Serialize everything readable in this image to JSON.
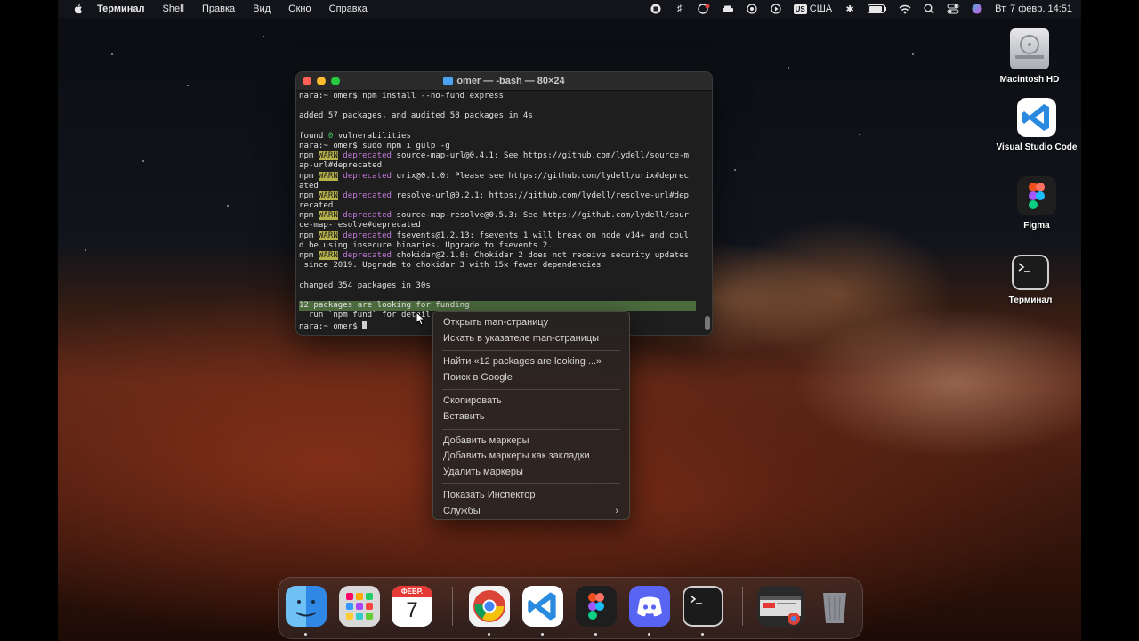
{
  "menubar": {
    "app_name": "Терминал",
    "items": [
      "Shell",
      "Правка",
      "Вид",
      "Окно",
      "Справка"
    ],
    "keyboard_layout": "США",
    "keyboard_badge": "US",
    "datetime": "Вт, 7 февр.  14:51"
  },
  "desktop_icons": [
    {
      "label": "Macintosh HD",
      "icon": "hard-drive-icon"
    },
    {
      "label": "Visual Studio Code",
      "icon": "vscode-icon"
    },
    {
      "label": "Figma",
      "icon": "figma-icon"
    },
    {
      "label": "Терминал",
      "icon": "terminal-icon"
    }
  ],
  "terminal": {
    "title": "omer — -bash — 80×24",
    "lines": [
      {
        "t": "nara:~ omer$ npm install --no-fund express"
      },
      {
        "t": ""
      },
      {
        "t": "added 57 packages, and audited 58 packages in 4s"
      },
      {
        "t": ""
      },
      {
        "pre": "found ",
        "zero": "0",
        "post": " vulnerabilities"
      },
      {
        "t": "nara:~ omer$ sudo npm i gulp -g"
      },
      {
        "npm": "npm ",
        "warn": "WARN",
        "dep": " deprecated",
        "post": " source-map-url@0.4.1: See https://github.com/lydell/source-m"
      },
      {
        "t": "ap-url#deprecated"
      },
      {
        "npm": "npm ",
        "warn": "WARN",
        "dep": " deprecated",
        "post": " urix@0.1.0: Please see https://github.com/lydell/urix#deprec"
      },
      {
        "t": "ated"
      },
      {
        "npm": "npm ",
        "warn": "WARN",
        "dep": " deprecated",
        "post": " resolve-url@0.2.1: https://github.com/lydell/resolve-url#dep"
      },
      {
        "t": "recated"
      },
      {
        "npm": "npm ",
        "warn": "WARN",
        "dep": " deprecated",
        "post": " source-map-resolve@0.5.3: See https://github.com/lydell/sour"
      },
      {
        "t": "ce-map-resolve#deprecated"
      },
      {
        "npm": "npm ",
        "warn": "WARN",
        "dep": " deprecated",
        "post": " fsevents@1.2.13: fsevents 1 will break on node v14+ and coul"
      },
      {
        "t": "d be using insecure binaries. Upgrade to fsevents 2."
      },
      {
        "npm": "npm ",
        "warn": "WARN",
        "dep": " deprecated",
        "post": " chokidar@2.1.8: Chokidar 2 does not receive security updates"
      },
      {
        "t": " since 2019. Upgrade to chokidar 3 with 15x fewer dependencies"
      },
      {
        "t": ""
      },
      {
        "t": "changed 354 packages in 30s"
      },
      {
        "t": ""
      },
      {
        "hl": "12 packages are looking for funding"
      },
      {
        "t": "  run `npm fund` for detail"
      },
      {
        "prompt": "nara:~ omer$ "
      }
    ]
  },
  "context_menu": {
    "groups": [
      [
        "Открыть man-страницу",
        "Искать в указателе man-страницы"
      ],
      [
        "Найти «12 packages are looking ...»",
        "Поиск в Google"
      ],
      [
        "Скопировать",
        "Вставить"
      ],
      [
        "Добавить маркеры",
        "Добавить маркеры как закладки",
        "Удалить маркеры"
      ],
      [
        "Показать Инспектор",
        "Службы"
      ]
    ],
    "submenu_chevron": "›"
  },
  "dock": {
    "calendar_month": "ФЕВР.",
    "calendar_day": "7",
    "apps": [
      "finder-icon",
      "launchpad-icon",
      "calendar-icon",
      "chrome-icon",
      "vscode-icon",
      "figma-icon",
      "discord-icon",
      "terminal-icon",
      "chrome-window-icon",
      "trash-icon"
    ]
  }
}
